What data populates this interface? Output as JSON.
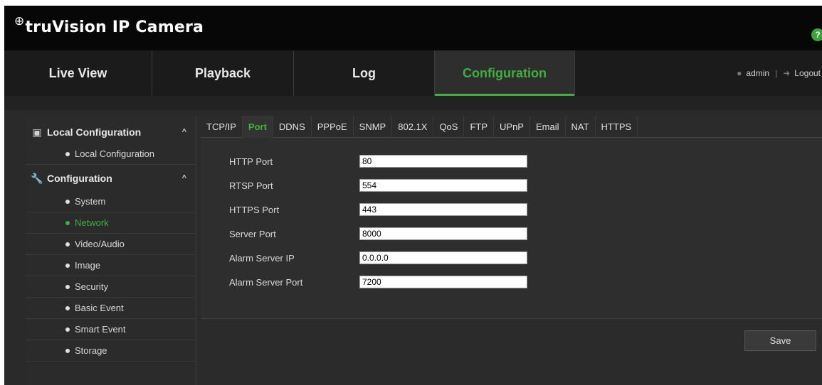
{
  "header": {
    "logo_mark": "⊕",
    "brand": "truVision IP Camera",
    "help_icon": "?"
  },
  "nav": {
    "tabs": [
      {
        "label": "Live View",
        "icon": "none"
      },
      {
        "label": "Playback",
        "icon": "none"
      },
      {
        "label": "Log",
        "icon": "none"
      },
      {
        "label": "Configuration",
        "icon": "none"
      }
    ],
    "active": "Configuration",
    "user": "admin",
    "separator": "|",
    "logout": "Logout",
    "accent_color": "#3db03d"
  },
  "sidebar": {
    "sections": [
      {
        "title": "Local Configuration",
        "icon": "local-config-icon",
        "caret": "^",
        "items": [
          "Local Configuration"
        ]
      },
      {
        "title": "Configuration",
        "icon": "wrench-icon",
        "caret": "^",
        "items": [
          "System",
          "Network",
          "Video/Audio",
          "Image",
          "Security",
          "Basic Event",
          "Smart Event",
          "Storage"
        ]
      }
    ],
    "active_item": "Network"
  },
  "tabs": [
    "TCP/IP",
    "Port",
    "DDNS",
    "PPPoE",
    "SNMP",
    "802.1X",
    "QoS",
    "FTP",
    "UPnP",
    "Email",
    "NAT",
    "HTTPS"
  ],
  "active_tab": "Port",
  "form": {
    "fields": [
      {
        "label": "HTTP Port",
        "value": "80"
      },
      {
        "label": "RTSP Port",
        "value": "554"
      },
      {
        "label": "HTTPS Port",
        "value": "443"
      },
      {
        "label": "Server Port",
        "value": "8000"
      },
      {
        "label": "Alarm Server IP",
        "value": "0.0.0.0"
      },
      {
        "label": "Alarm Server Port",
        "value": "7200"
      }
    ],
    "save_label": "Save"
  }
}
